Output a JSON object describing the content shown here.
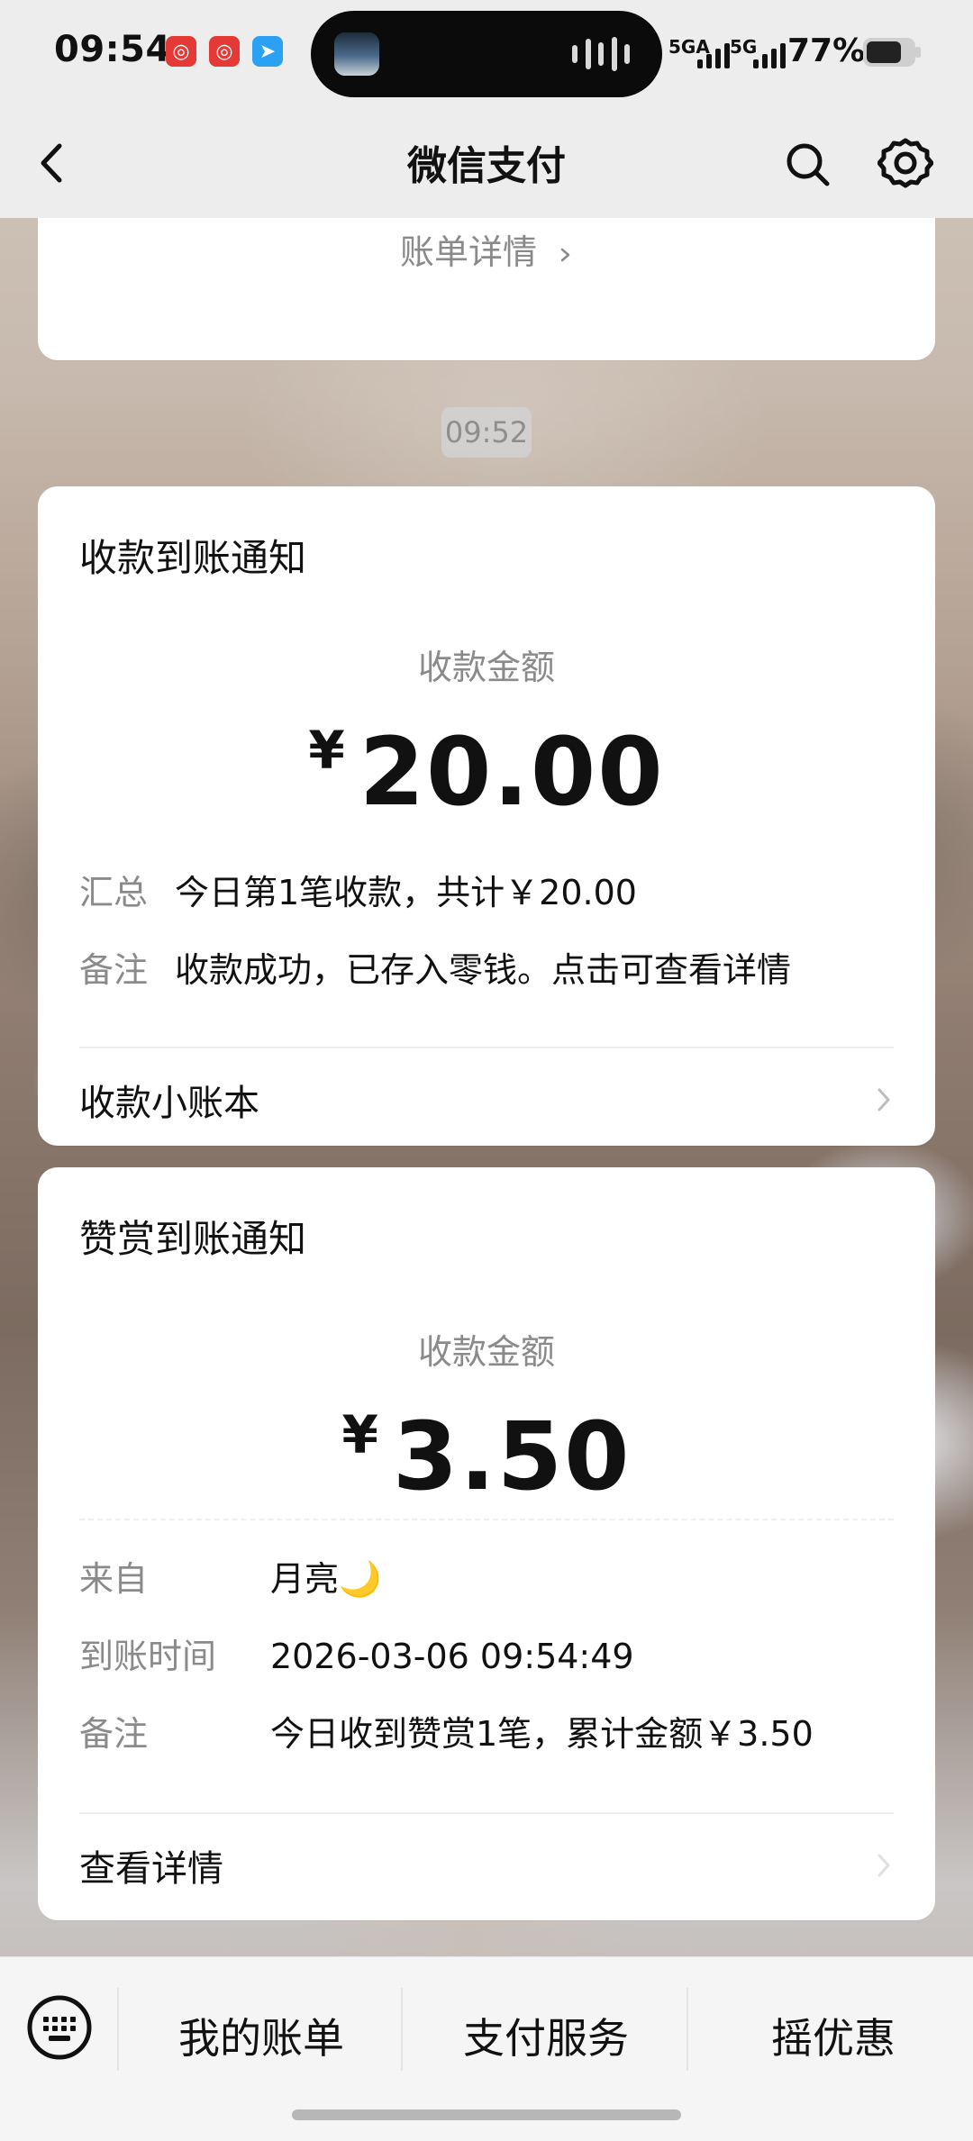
{
  "status_bar": {
    "time": "09:54",
    "network_left": "5GA",
    "network_right": "5G",
    "battery": "77%"
  },
  "header": {
    "title": "微信支付"
  },
  "top_card": {
    "link": "账单详情"
  },
  "timestamp": "09:52",
  "cards": [
    {
      "title": "收款到账通知",
      "amount_label": "收款金额",
      "amount_prefix": "¥",
      "amount": "20.00",
      "rows": [
        {
          "k": "汇总",
          "v": "今日第1笔收款，共计￥20.00"
        },
        {
          "k": "备注",
          "v": "收款成功，已存入零钱。点击可查看详情"
        }
      ],
      "footer": "收款小账本"
    },
    {
      "title": "赞赏到账通知",
      "amount_label": "收款金额",
      "amount_prefix": "¥",
      "amount": "3.50",
      "rows": [
        {
          "k": "来自",
          "v": "月亮🌙"
        },
        {
          "k": "到账时间",
          "v": "2026-03-06 09:54:49"
        },
        {
          "k": "备注",
          "v": "今日收到赞赏1笔，累计金额￥3.50"
        }
      ],
      "footer": "查看详情"
    }
  ],
  "bottom_bar": {
    "items": [
      "我的账单",
      "支付服务",
      "摇优惠"
    ]
  },
  "colors": {
    "accent_text": "#111111",
    "secondary_text": "#8a8a8a",
    "bar_bg": "#ededed",
    "card_bg": "#ffffff"
  }
}
